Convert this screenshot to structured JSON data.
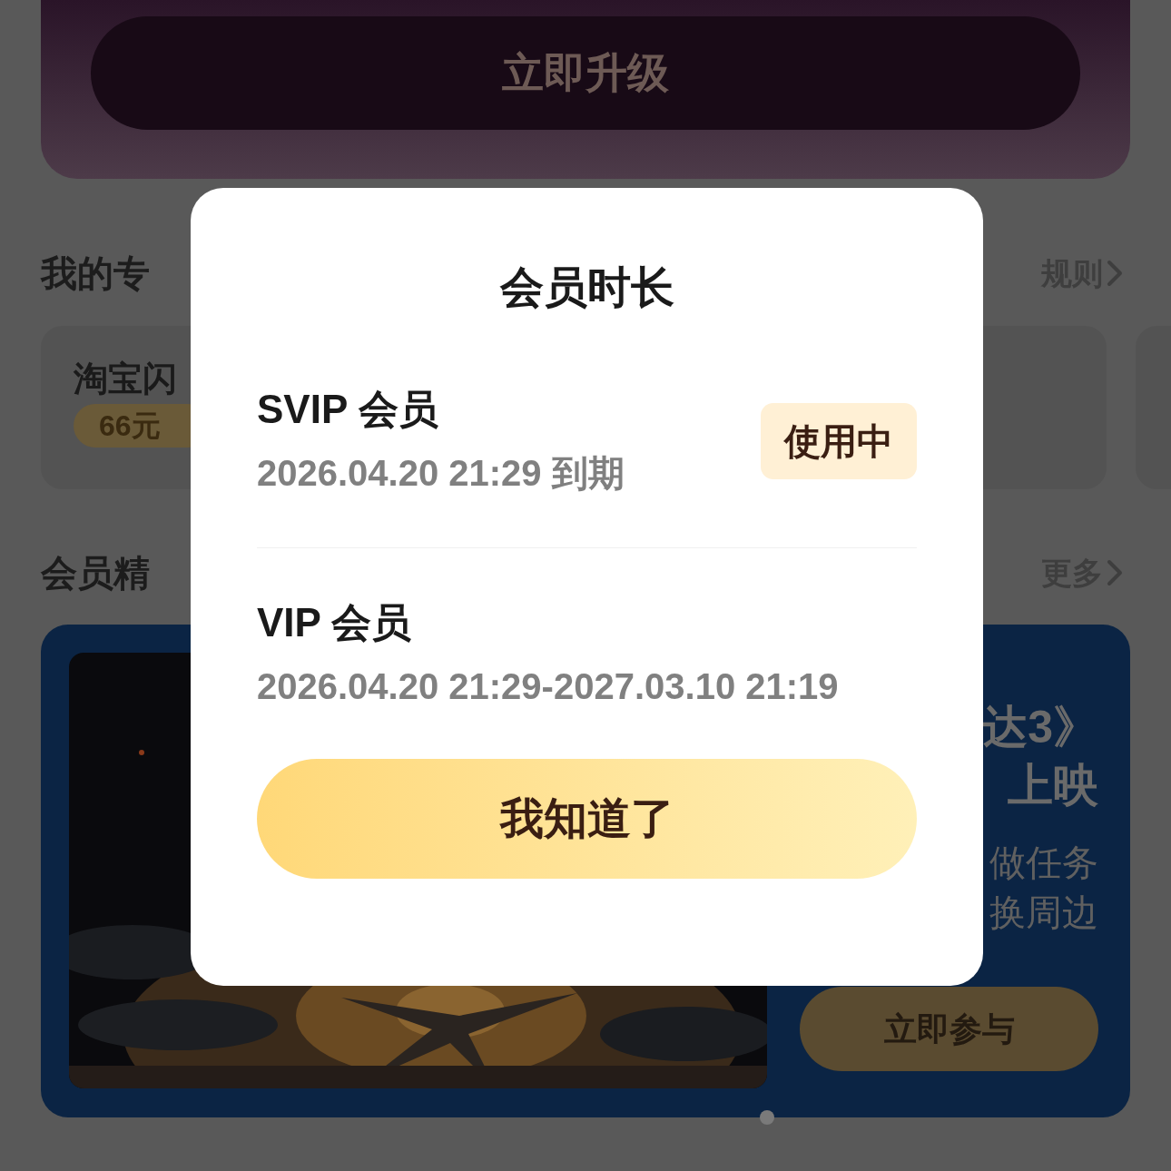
{
  "upgrade_card": {
    "button": "立即升级"
  },
  "sections": [
    {
      "title": "我的专",
      "link": "规则"
    },
    {
      "title": "会员精",
      "link": "更多"
    }
  ],
  "benefit_card": {
    "title": "淘宝闪",
    "badge": "66元"
  },
  "banner": {
    "headline": [
      "达3》",
      "上映"
    ],
    "lines": [
      "做任务",
      "换周边"
    ],
    "button": "立即参与"
  },
  "dialog": {
    "title": "会员时长",
    "memberships": [
      {
        "name": "SVIP 会员",
        "period": "2026.04.20 21:29 到期",
        "in_use": true,
        "status": "使用中"
      },
      {
        "name": "VIP 会员",
        "period": "2026.04.20 21:29-2027.03.10 21:19",
        "in_use": false
      }
    ],
    "button": "我知道了"
  }
}
